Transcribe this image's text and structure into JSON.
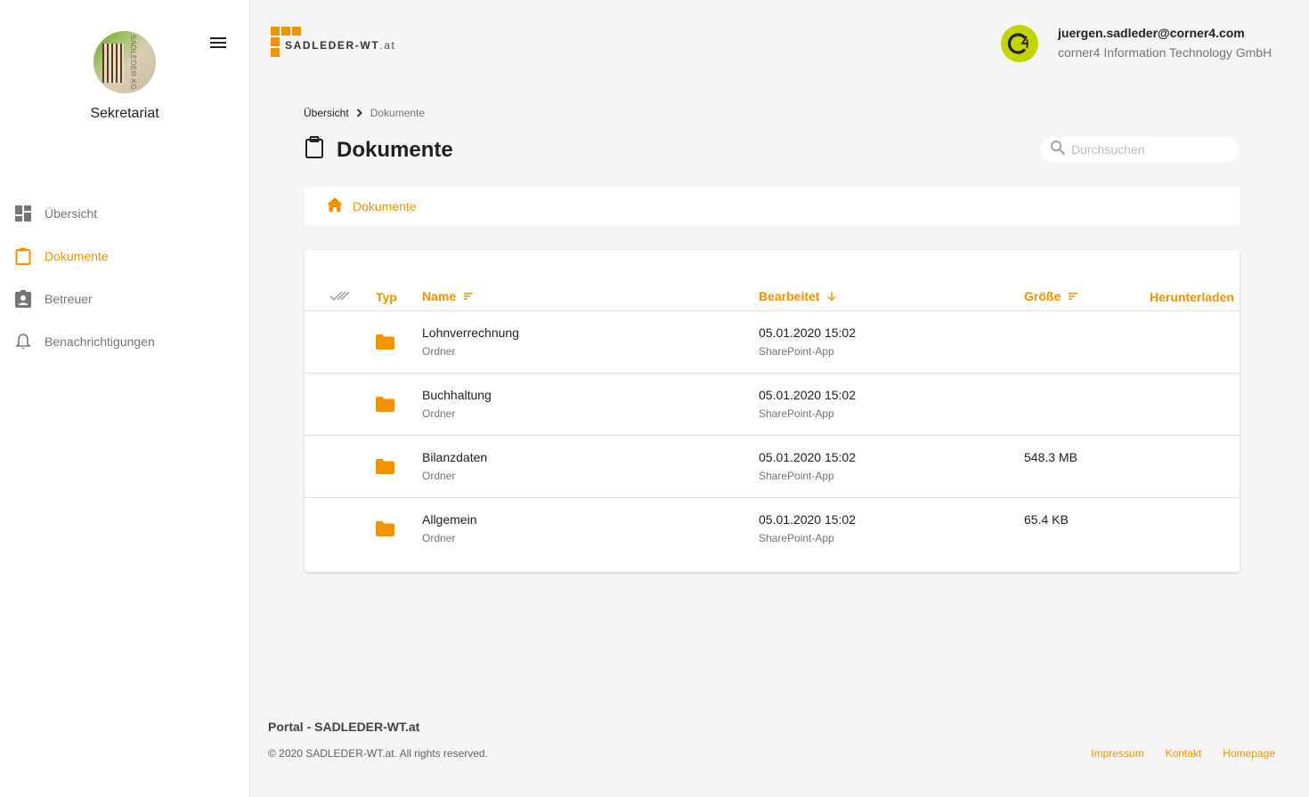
{
  "sidebar": {
    "avatar_text": "SADLEDER KG",
    "profile_name": "Sekretariat",
    "items": [
      {
        "label": "Übersicht",
        "icon": "dashboard-icon"
      },
      {
        "label": "Dokumente",
        "icon": "clipboard-icon",
        "active": true
      },
      {
        "label": "Betreuer",
        "icon": "assignment-ind-icon"
      },
      {
        "label": "Benachrichtigungen",
        "icon": "bell-icon"
      }
    ]
  },
  "header": {
    "logo_text": "SADLEDER-WT",
    "logo_tld": ".at",
    "user_email": "juergen.sadleder@corner4.com",
    "user_company": "corner4 Information Technology GmbH"
  },
  "breadcrumb": {
    "home": "Übersicht",
    "current": "Dokumente"
  },
  "page": {
    "title": "Dokumente"
  },
  "search": {
    "placeholder": "Durchsuchen"
  },
  "pathbar": {
    "label": "Dokumente"
  },
  "table": {
    "columns": {
      "type": "Typ",
      "name": "Name",
      "edited": "Bearbeitet",
      "size": "Größe",
      "download": "Herunterladen"
    },
    "rows": [
      {
        "name": "Lohnverrechnung",
        "kind": "Ordner",
        "date": "05.01.2020 15:02",
        "editor": "SharePoint-App",
        "size": ""
      },
      {
        "name": "Buchhaltung",
        "kind": "Ordner",
        "date": "05.01.2020 15:02",
        "editor": "SharePoint-App",
        "size": ""
      },
      {
        "name": "Bilanzdaten",
        "kind": "Ordner",
        "date": "05.01.2020 15:02",
        "editor": "SharePoint-App",
        "size": "548.3 MB"
      },
      {
        "name": "Allgemein",
        "kind": "Ordner",
        "date": "05.01.2020 15:02",
        "editor": "SharePoint-App",
        "size": "65.4 KB"
      }
    ]
  },
  "footer": {
    "title": "Portal - SADLEDER-WT.at",
    "copyright": "© 2020 SADLEDER-WT.at. All rights reserved.",
    "links": [
      "Impressum",
      "Kontakt",
      "Homepage"
    ]
  },
  "colors": {
    "accent": "#f39200",
    "user_badge": "#c3d400"
  }
}
